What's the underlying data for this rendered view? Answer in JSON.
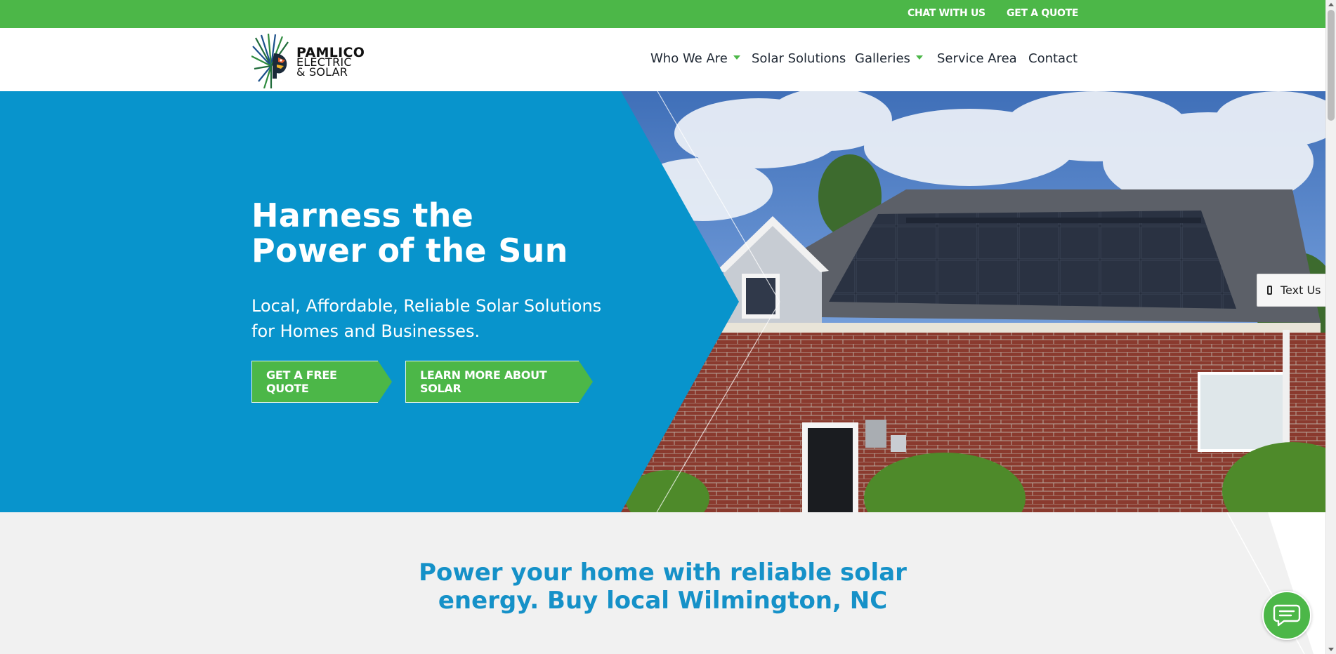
{
  "topbar": {
    "chat_label": "CHAT WITH US",
    "quote_label": "GET A QUOTE",
    "bg_color": "#4cb748"
  },
  "logo": {
    "line1": "PAMLICO",
    "line2": "ELECTRIC",
    "line3": "& SOLAR",
    "icon": "feather-headdress-icon"
  },
  "nav": {
    "items": [
      {
        "label": "Who We Are",
        "has_dropdown": true
      },
      {
        "label": "Solar Solutions",
        "has_dropdown": false
      },
      {
        "label": "Galleries",
        "has_dropdown": true
      },
      {
        "label": "Service Area",
        "has_dropdown": false
      },
      {
        "label": "Contact",
        "has_dropdown": false
      }
    ]
  },
  "hero": {
    "title_line1": "Harness the",
    "title_line2": "Power of the Sun",
    "subtitle": "Local, Affordable, Reliable Solar Solutions for Homes and Businesses.",
    "cta_primary": "GET A FREE QUOTE",
    "cta_secondary": "LEARN MORE ABOUT SOLAR",
    "bg_color": "#0894cc",
    "image": "house-with-solar-panels-photo"
  },
  "text_us": {
    "label": "Text Us",
    "icon": "mobile-phone-icon"
  },
  "section": {
    "title_line1": "Power your home with reliable solar",
    "title_line2": "energy. Buy local Wilmington, NC",
    "title_color": "#1591c8"
  },
  "chat_widget": {
    "icon": "chat-bubble-icon",
    "color": "#4cb748"
  }
}
